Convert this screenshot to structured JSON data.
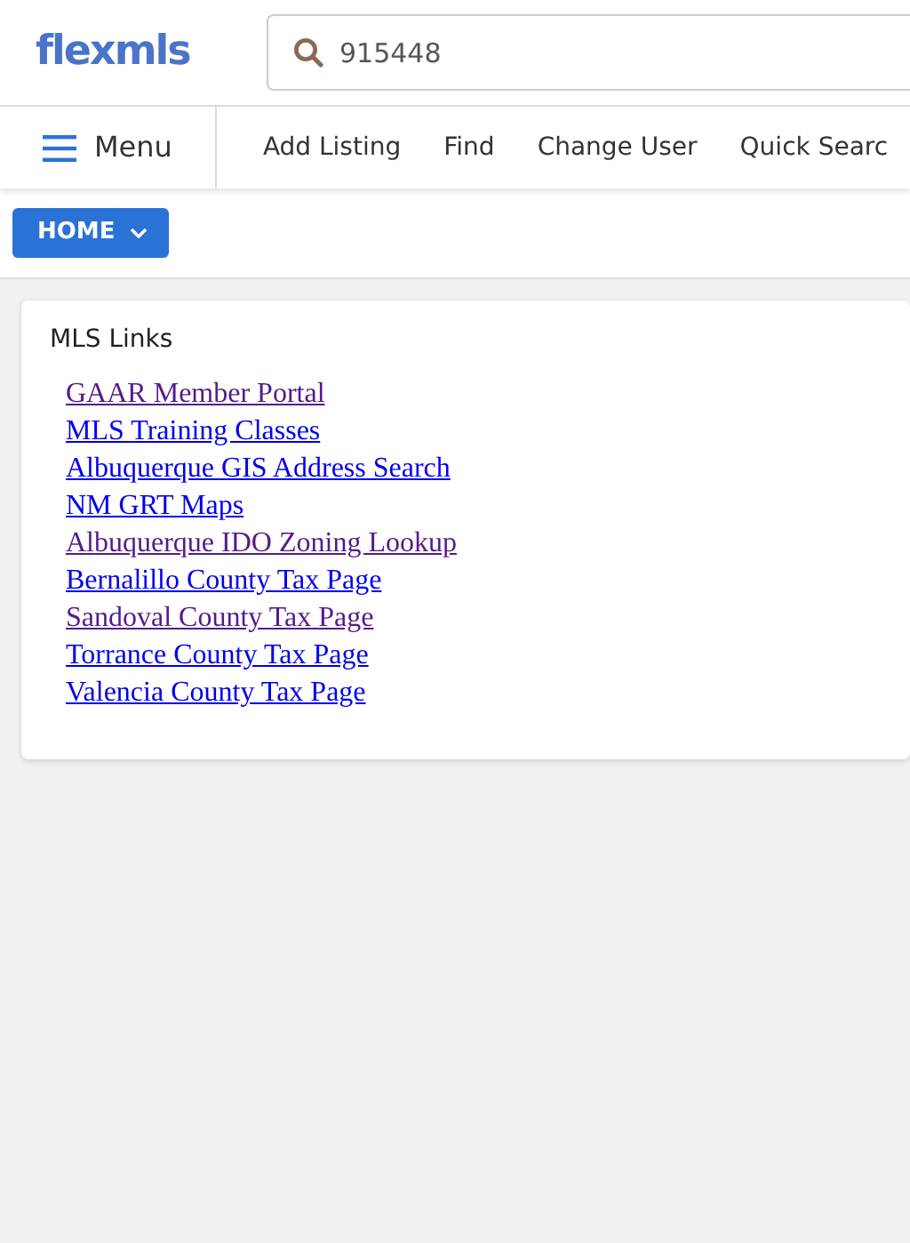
{
  "logo": "flexmls",
  "search": {
    "value": "915448"
  },
  "menu": {
    "label": "Menu"
  },
  "nav_items": [
    "Add Listing",
    "Find",
    "Change User",
    "Quick Searc"
  ],
  "home_button": {
    "label": "HOME"
  },
  "panel": {
    "title": "MLS Links",
    "links": [
      {
        "label": "GAAR Member Portal",
        "visited": true
      },
      {
        "label": "MLS Training Classes",
        "visited": false
      },
      {
        "label": "Albuquerque GIS Address Search",
        "visited": false
      },
      {
        "label": "NM GRT Maps",
        "visited": false
      },
      {
        "label": "Albuquerque IDO Zoning Lookup",
        "visited": true
      },
      {
        "label": "Bernalillo County Tax Page",
        "visited": false
      },
      {
        "label": "Sandoval County Tax Page",
        "visited": true
      },
      {
        "label": "Torrance County Tax Page",
        "visited": false
      },
      {
        "label": "Valencia County Tax Page",
        "visited": false
      }
    ]
  }
}
